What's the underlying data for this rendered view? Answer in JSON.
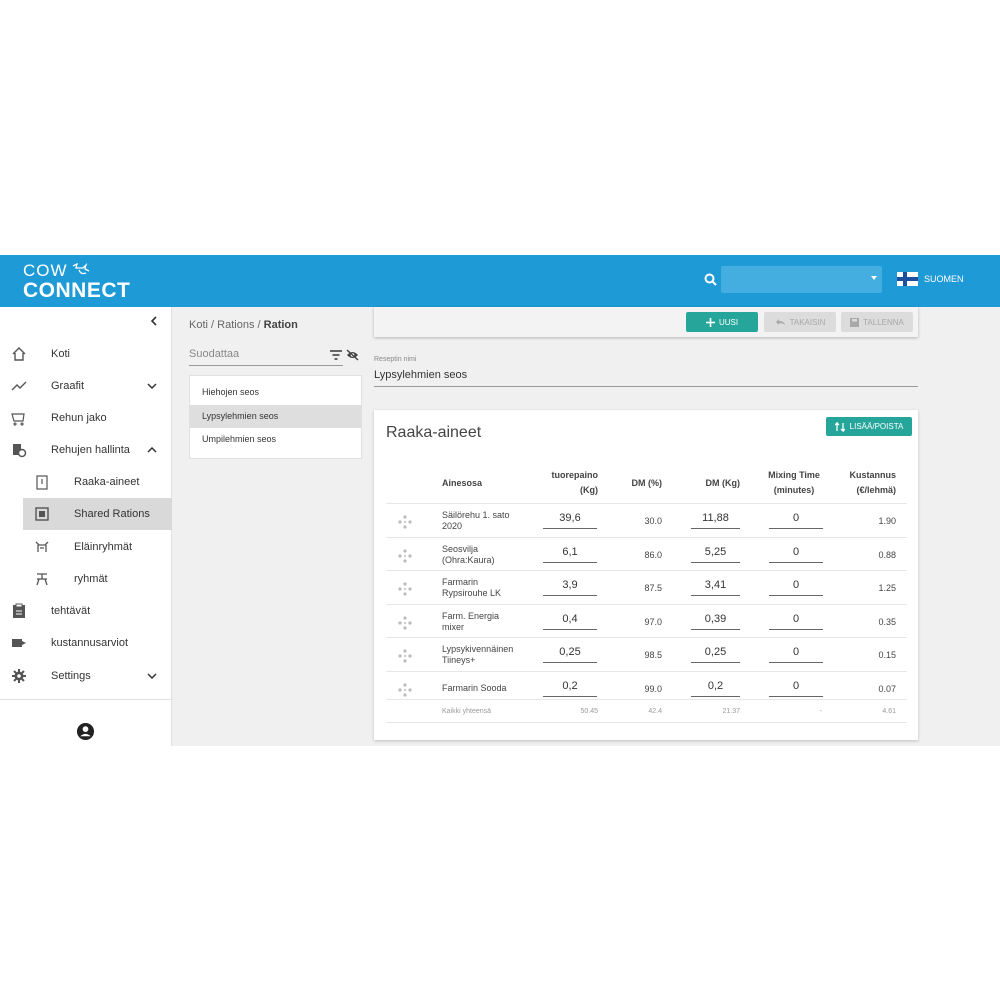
{
  "header": {
    "logo_top": "COW",
    "logo_bottom": "CONNECT",
    "search_value": "",
    "language": "SUOMEN"
  },
  "sidebar": {
    "items": [
      {
        "label": "Koti",
        "icon": "home-icon"
      },
      {
        "label": "Graafit",
        "icon": "trending-up-icon"
      },
      {
        "label": "Rehun jako",
        "icon": "wagon-icon"
      },
      {
        "label": "Rehujen hallinta",
        "icon": "feed-settings-icon"
      },
      {
        "label": "Raaka-aineet",
        "icon": "silo-icon"
      },
      {
        "label": "Shared Rations",
        "icon": "shared-rations-icon"
      },
      {
        "label": "Eläinryhmät",
        "icon": "animal-groups-icon"
      },
      {
        "label": "ryhmät",
        "icon": "groups-icon"
      },
      {
        "label": "tehtävät",
        "icon": "clipboard-icon"
      },
      {
        "label": "kustannusarviot",
        "icon": "money-icon"
      },
      {
        "label": "Settings",
        "icon": "gear-icon"
      }
    ]
  },
  "breadcrumb": {
    "home": "Koti",
    "rations": "Rations",
    "current": "Ration",
    "sep": "/"
  },
  "filter": {
    "placeholder": "Suodattaa"
  },
  "ration_list": [
    "Hiehojen seos",
    "Lypsylehmien seos",
    "Umpilehmien seos"
  ],
  "toolbar": {
    "new": "UUSI",
    "back": "TAKAISIN",
    "save": "TALLENNA"
  },
  "recipe": {
    "label": "Reseptin nimi",
    "value": "Lypsylehmien seos"
  },
  "card": {
    "title": "Raaka-aineet",
    "add_button": "LISÄÄ/POISTA",
    "columns": {
      "name": "Ainesosa",
      "fresh_1": "tuorepaino",
      "fresh_2": "(Kg)",
      "dm_pct": "DM (%)",
      "dm_kg": "DM (Kg)",
      "mix_1": "Mixing Time",
      "mix_2": "(minutes)",
      "cost_1": "Kustannus",
      "cost_2": "(€/lehmä)"
    },
    "rows": [
      {
        "name_1": "Säilörehu 1. sato",
        "name_2": "2020",
        "fresh": "39,6",
        "dm_pct": "30.0",
        "dm_kg": "11,88",
        "mix": "0",
        "cost": "1.90"
      },
      {
        "name_1": "Seosvilja",
        "name_2": "(Ohra:Kaura)",
        "fresh": "6,1",
        "dm_pct": "86.0",
        "dm_kg": "5,25",
        "mix": "0",
        "cost": "0.88"
      },
      {
        "name_1": "Farmarin",
        "name_2": "Rypsirouhe LK",
        "fresh": "3,9",
        "dm_pct": "87.5",
        "dm_kg": "3,41",
        "mix": "0",
        "cost": "1.25"
      },
      {
        "name_1": "Farm. Energia",
        "name_2": "mixer",
        "fresh": "0,4",
        "dm_pct": "97.0",
        "dm_kg": "0,39",
        "mix": "0",
        "cost": "0.35"
      },
      {
        "name_1": "Lypsykivennäinen",
        "name_2": "Tiineys+",
        "fresh": "0,25",
        "dm_pct": "98.5",
        "dm_kg": "0,25",
        "mix": "0",
        "cost": "0.15"
      },
      {
        "name_1": "Farmarin Sooda",
        "name_2": "",
        "fresh": "0,2",
        "dm_pct": "99.0",
        "dm_kg": "0,2",
        "mix": "0",
        "cost": "0.07"
      }
    ],
    "totals": {
      "label": "Kaikki yhteensä",
      "fresh": "50.45",
      "dm_pct": "42.4",
      "dm_kg": "21.37",
      "mix": "-",
      "cost": "4.61"
    }
  },
  "colors": {
    "header": "#1e9ad6",
    "accent": "#26a69a"
  }
}
